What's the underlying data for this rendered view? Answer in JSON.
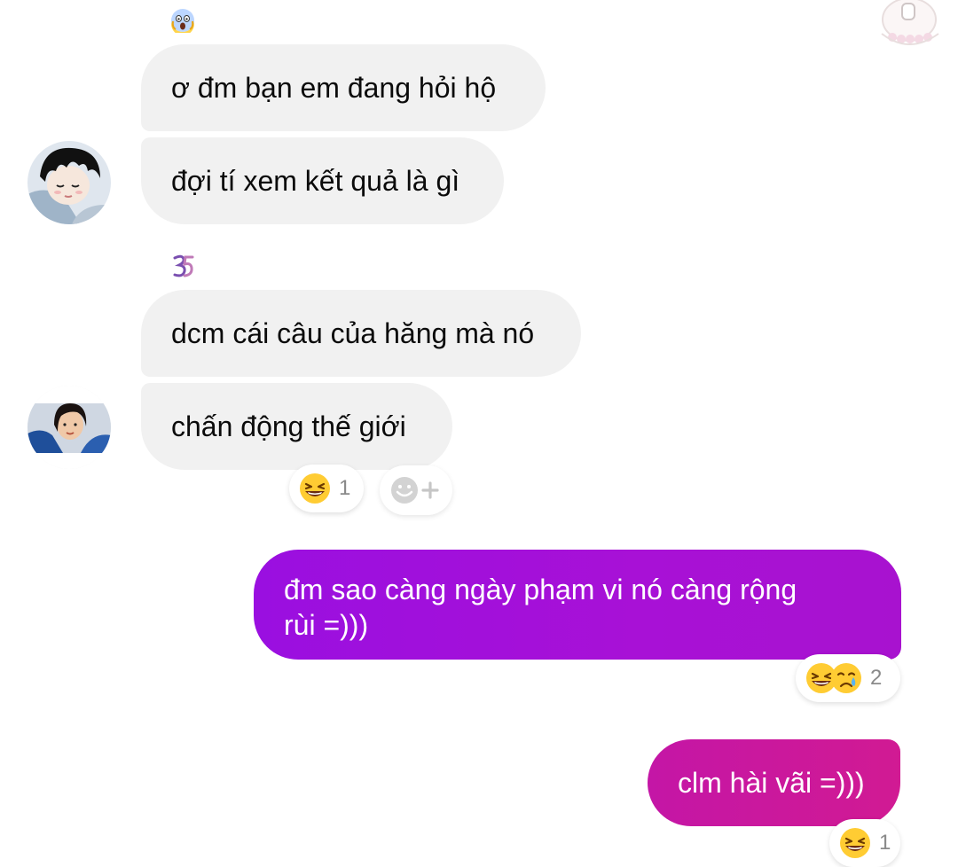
{
  "messages": {
    "m1": {
      "text": "ơ đm bạn em đang hỏi hộ"
    },
    "m2": {
      "text": "đợi tí xem kết quả là gì"
    },
    "m3": {
      "text": "dcm cái câu của hăng mà nó"
    },
    "m4": {
      "text": "chấn động thế giới"
    },
    "m5": {
      "line1": "đm sao càng ngày phạm vi nó càng rộng",
      "line2": "rùi =)))"
    },
    "m6": {
      "text": "clm hài vãi =)))"
    }
  },
  "reactions": {
    "m4": {
      "emoji": "laughing-face",
      "count": "1"
    },
    "m5": {
      "emojis": [
        "laughing-face",
        "crying-face"
      ],
      "count": "2"
    },
    "m6": {
      "emoji": "laughing-face",
      "count": "1"
    }
  },
  "colors": {
    "incoming_bubble": "#f1f1f1",
    "outgoing_bubble_1": "#a811d6",
    "outgoing_bubble_2": "#d11a93",
    "reaction_count": "#8a8a8a"
  }
}
